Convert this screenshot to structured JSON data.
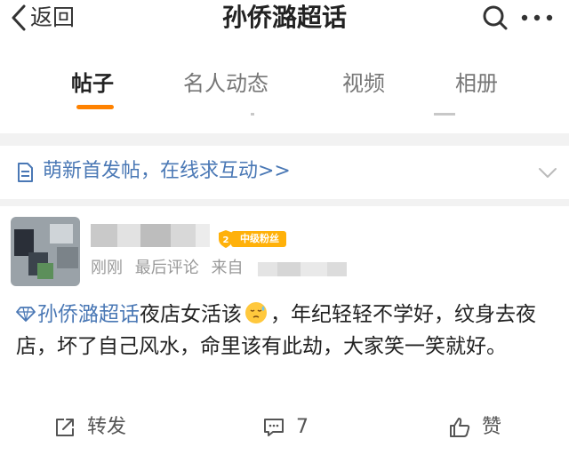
{
  "header": {
    "back_label": "返回",
    "title": "孙侨潞超话"
  },
  "tabs": [
    {
      "label": "帖子",
      "active": true
    },
    {
      "label": "名人动态",
      "active": false
    },
    {
      "label": "视频",
      "active": false
    },
    {
      "label": "相册",
      "active": false
    }
  ],
  "banner": {
    "text": "萌新首发帖，在线求互动>>"
  },
  "post": {
    "badge_label": "中级粉丝",
    "badge_level": "2",
    "meta_time": "刚刚",
    "meta_sort": "最后评论",
    "meta_source_prefix": "来自",
    "content": {
      "topic": "孙侨潞超话",
      "text_before_emoji": "夜店女活该",
      "text_after_emoji": "，年纪轻轻不学好，纹身去夜店，坏了自己风水，命里该有此劫，大家笑一笑就好。"
    }
  },
  "actions": {
    "repost_label": "转发",
    "comment_count": "7",
    "like_label": "赞"
  },
  "colors": {
    "accent": "#ff8200",
    "link": "#4a78b5",
    "badge": "#ffb10a"
  },
  "icons": [
    "back-chevron-icon",
    "search-icon",
    "more-icon",
    "document-icon",
    "chevron-down-icon",
    "super-topic-icon",
    "sweat-emoji-icon",
    "repost-icon",
    "comment-icon",
    "like-icon"
  ]
}
